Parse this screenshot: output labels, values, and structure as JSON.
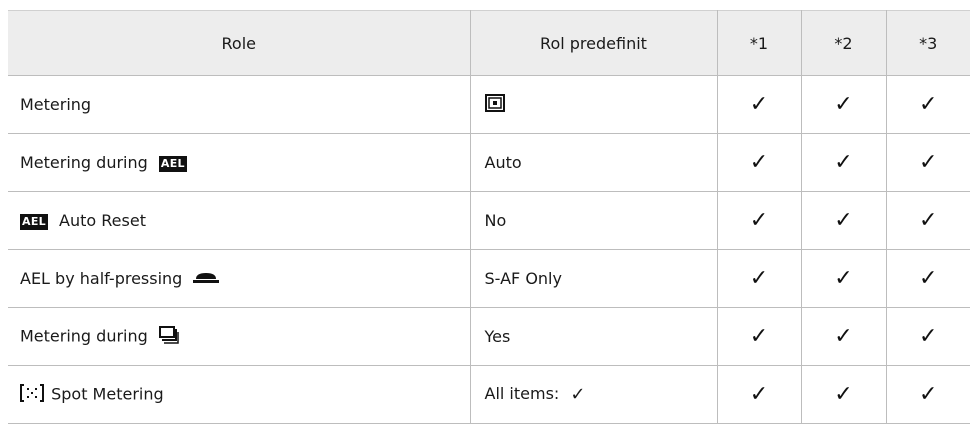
{
  "table": {
    "headers": {
      "role": "Role",
      "default": "Rol predefinit",
      "c1": "*1",
      "c2": "*2",
      "c3": "*3"
    },
    "check_symbol": "✓",
    "rows": [
      {
        "role": "Metering",
        "role_icon": "evaluative-metering-icon",
        "default": "",
        "default_icon": "evaluative-metering-icon"
      },
      {
        "role": "Metering during",
        "role_icon": "ael-icon",
        "ael_text": "AEL",
        "default": "Auto"
      },
      {
        "role": "Auto Reset",
        "role_icon": "ael-icon",
        "ael_text": "AEL",
        "default": "No"
      },
      {
        "role": "AEL by half-pressing",
        "role_icon": "shutter-button-icon",
        "default": "S-AF Only"
      },
      {
        "role": "Metering during",
        "role_icon": "sequential-shooting-icon",
        "default": "Yes"
      },
      {
        "role": "Spot Metering",
        "role_icon": "spot-metering-icon",
        "default": "All items:",
        "default_icon": "check-icon"
      }
    ]
  }
}
